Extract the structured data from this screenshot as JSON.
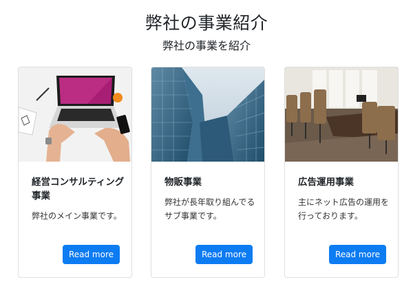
{
  "header": {
    "title": "弊社の事業紹介",
    "subtitle": "弊社の事業を紹介"
  },
  "cards": [
    {
      "title": "経営コンサルティング事業",
      "text": "弊社のメイン事業です。",
      "button": "Read more",
      "image": "laptop-typing-photo"
    },
    {
      "title": "物販事業",
      "text": "弊社が長年取り組んでるサブ事業です。",
      "button": "Read more",
      "image": "glass-office-buildings-photo"
    },
    {
      "title": "広告運用事業",
      "text": "主にネット広告の運用を行っております。",
      "button": "Read more",
      "image": "conference-room-photo"
    }
  ],
  "colors": {
    "button": "#0d7cf2",
    "button_text": "#ffffff",
    "card_border": "#dfdfdf"
  }
}
